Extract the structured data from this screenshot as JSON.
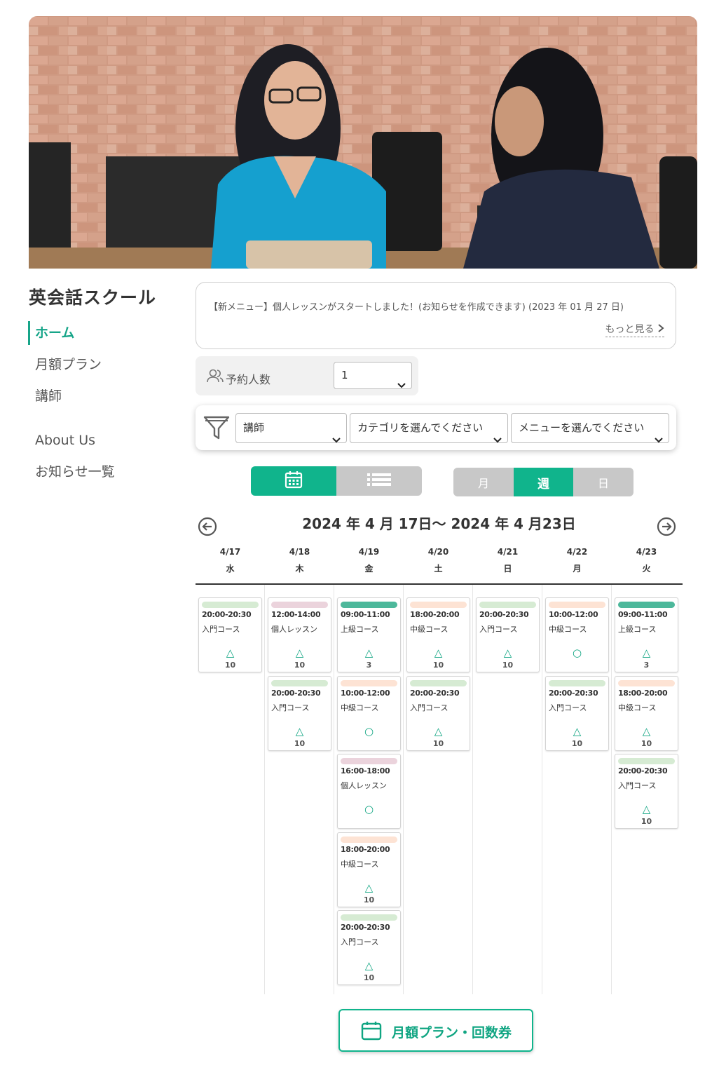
{
  "brand": {
    "title": "英会話スクール"
  },
  "nav": {
    "home": "ホーム",
    "monthly_plan": "月額プラン",
    "instructors": "講師",
    "about": "About Us",
    "news": "お知らせ一覧"
  },
  "notice": {
    "text": "【新メニュー】個人レッスンがスタートしました！(お知らせを作成できます) (2023 年 01 月 27 日)",
    "more": "もっと見る"
  },
  "booking": {
    "people_label": "予約人数",
    "people_value": "1"
  },
  "filters": {
    "instructor": "講師",
    "category": "カテゴリを選んでください",
    "menu": "メニューを選んでください"
  },
  "view": {
    "calendar_icon": "calendar-icon",
    "list_icon": "list-icon",
    "period_month": "月",
    "period_week": "週",
    "period_day": "日",
    "active_period": "週"
  },
  "calendar": {
    "range": "2024 年 4 月 17日〜 2024 年 4 月23日",
    "days": [
      {
        "date": "4/17",
        "weekday": "水"
      },
      {
        "date": "4/18",
        "weekday": "木"
      },
      {
        "date": "4/19",
        "weekday": "金"
      },
      {
        "date": "4/20",
        "weekday": "土"
      },
      {
        "date": "4/21",
        "weekday": "日"
      },
      {
        "date": "4/22",
        "weekday": "月"
      },
      {
        "date": "4/23",
        "weekday": "火"
      }
    ],
    "slots": [
      {
        "day": 0,
        "row": 0,
        "time": "20:00-20:30",
        "course": "入門コース",
        "mark": "△",
        "count": "10",
        "color": "#d6ebd3"
      },
      {
        "day": 1,
        "row": 0,
        "time": "12:00-14:00",
        "course": "個人レッスン",
        "mark": "△",
        "count": "10",
        "color": "#ebd3dc"
      },
      {
        "day": 1,
        "row": 1,
        "time": "20:00-20:30",
        "course": "入門コース",
        "mark": "△",
        "count": "10",
        "color": "#d6ebd3"
      },
      {
        "day": 2,
        "row": 0,
        "time": "09:00-11:00",
        "course": "上級コース",
        "mark": "△",
        "count": "3",
        "color": "#4db89b"
      },
      {
        "day": 2,
        "row": 1,
        "time": "10:00-12:00",
        "course": "中級コース",
        "mark": "○",
        "count": "",
        "color": "#fde3d4"
      },
      {
        "day": 2,
        "row": 2,
        "time": "16:00-18:00",
        "course": "個人レッスン",
        "mark": "○",
        "count": "",
        "color": "#ebd3dc"
      },
      {
        "day": 2,
        "row": 3,
        "time": "18:00-20:00",
        "course": "中級コース",
        "mark": "△",
        "count": "10",
        "color": "#fde3d4"
      },
      {
        "day": 2,
        "row": 4,
        "time": "20:00-20:30",
        "course": "入門コース",
        "mark": "△",
        "count": "10",
        "color": "#d6ebd3"
      },
      {
        "day": 3,
        "row": 0,
        "time": "18:00-20:00",
        "course": "中級コース",
        "mark": "△",
        "count": "10",
        "color": "#fde3d4"
      },
      {
        "day": 3,
        "row": 1,
        "time": "20:00-20:30",
        "course": "入門コース",
        "mark": "△",
        "count": "10",
        "color": "#d6ebd3"
      },
      {
        "day": 4,
        "row": 0,
        "time": "20:00-20:30",
        "course": "入門コース",
        "mark": "△",
        "count": "10",
        "color": "#d6ebd3"
      },
      {
        "day": 5,
        "row": 0,
        "time": "10:00-12:00",
        "course": "中級コース",
        "mark": "○",
        "count": "",
        "color": "#fde3d4"
      },
      {
        "day": 5,
        "row": 1,
        "time": "20:00-20:30",
        "course": "入門コース",
        "mark": "△",
        "count": "10",
        "color": "#d6ebd3"
      },
      {
        "day": 6,
        "row": 0,
        "time": "09:00-11:00",
        "course": "上級コース",
        "mark": "△",
        "count": "3",
        "color": "#4db89b"
      },
      {
        "day": 6,
        "row": 1,
        "time": "18:00-20:00",
        "course": "中級コース",
        "mark": "△",
        "count": "10",
        "color": "#fde3d4"
      },
      {
        "day": 6,
        "row": 2,
        "time": "20:00-20:30",
        "course": "入門コース",
        "mark": "△",
        "count": "10",
        "color": "#d6ebd3"
      }
    ]
  },
  "cta": {
    "label": "月額プラン・回数券"
  },
  "colors": {
    "accent": "#10b48c",
    "accent_text": "#17a589",
    "inactive": "#c8c8c8"
  }
}
